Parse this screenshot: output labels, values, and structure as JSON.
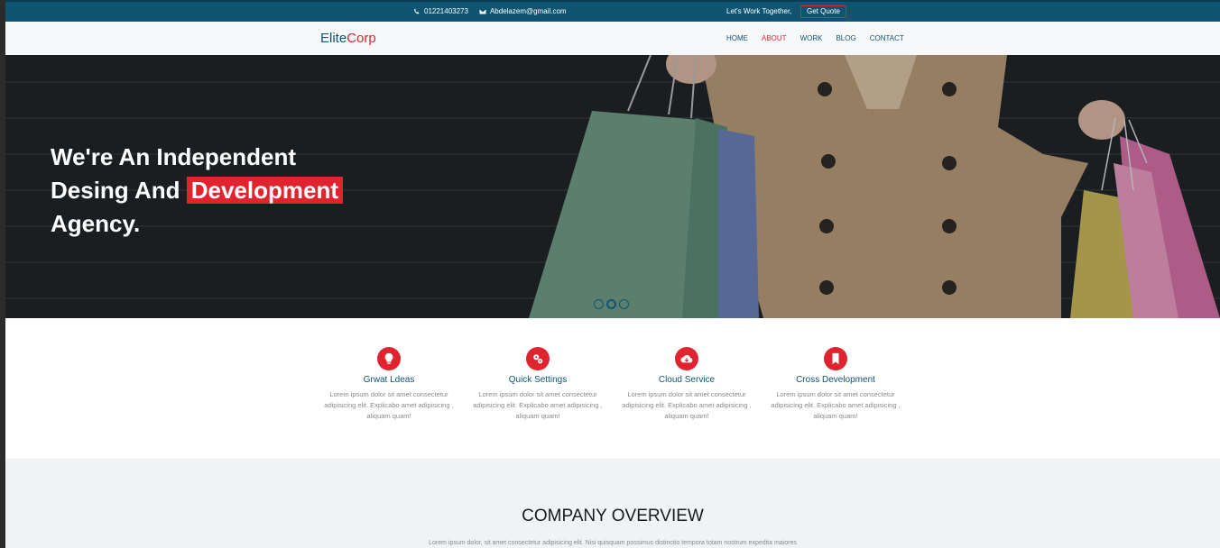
{
  "topbar": {
    "phone": "01221403273",
    "email": "Abdelazem@gmail.com",
    "work_text": "Let's Work Together,",
    "quote_label": "Get Quote"
  },
  "nav": {
    "logo_main": "Elite",
    "logo_accent": "Corp",
    "items": [
      {
        "label": "HOME",
        "active": false
      },
      {
        "label": "ABOUT",
        "active": true
      },
      {
        "label": "WORK",
        "active": false
      },
      {
        "label": "BLOG",
        "active": false
      },
      {
        "label": "CONTACT",
        "active": false
      }
    ]
  },
  "hero": {
    "line1": "We're An Independent",
    "line2_pre": "Desing And ",
    "line2_highlight": "Development",
    "line3": "Agency.",
    "slides": 3,
    "active_slide": 2
  },
  "features": [
    {
      "icon": "lightbulb-icon",
      "title": "Grwat Ldeas",
      "text": "Lorem ipsum dolor sit amet consectetur adipisicing elit. Explicabo amet adipisicing , aliquam quam!"
    },
    {
      "icon": "gears-icon",
      "title": "Quick Settings",
      "text": "Lorem ipsum dolor sit amet consectetur adipisicing elit. Explicabo amet adipisicing , aliquam quam!"
    },
    {
      "icon": "cloud-download-icon",
      "title": "Cloud Service",
      "text": "Lorem ipsum dolor sit amet consectetur adipisicing elit. Explicabo amet adipisicing , aliquam quam!"
    },
    {
      "icon": "bookmark-icon",
      "title": "Cross Development",
      "text": "Lorem ipsum dolor sit amet consectetur adipisicing elit. Explicabo amet adipisicing , aliquam quam!"
    }
  ],
  "overview": {
    "title": "COMPANY OVERVIEW",
    "text": "Lorem ipsum dolor, sit amet consectetur adipisicing elit. Nisi quisquam possimus distinctio tempora totam nostrum expedita maiores"
  },
  "colors": {
    "primary": "#0f5470",
    "accent": "#e0242f",
    "overview_bg": "#eff3f6"
  }
}
